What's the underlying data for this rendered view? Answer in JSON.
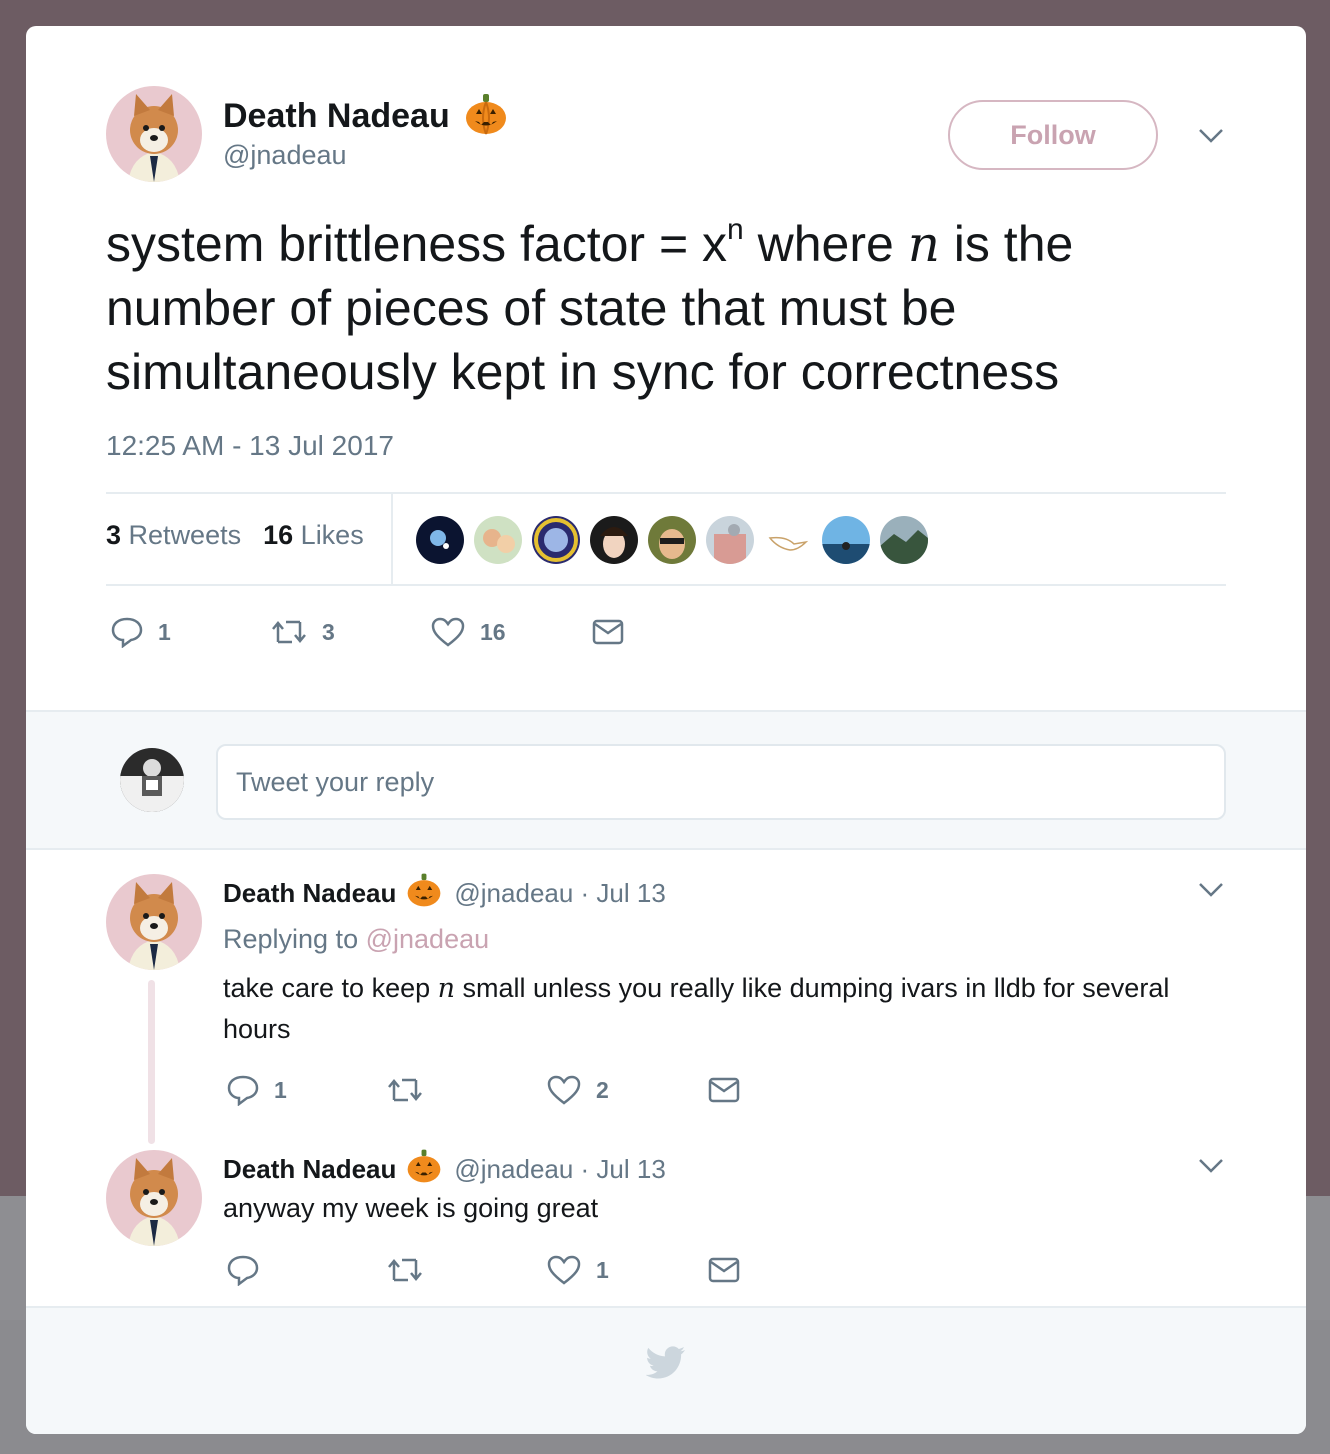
{
  "tweet": {
    "author_name": "Death Nadeau",
    "author_handle": "@jnadeau",
    "follow_label": "Follow",
    "text_part1": "system brittleness factor = x",
    "text_sup": "n",
    "text_part2": " where ",
    "text_var": "n",
    "text_part3": " is the number of pieces of state that must be simultaneously kept in sync for correctness",
    "timestamp": "12:25 AM - 13 Jul 2017",
    "retweets_count": "3",
    "retweets_label": "Retweets",
    "likes_count": "16",
    "likes_label": "Likes",
    "actions": {
      "replies": "1",
      "retweets": "3",
      "likes": "16"
    }
  },
  "reply_box": {
    "placeholder": "Tweet your reply"
  },
  "replies": [
    {
      "name": "Death Nadeau",
      "handle_date": "@jnadeau · Jul 13",
      "replying_prefix": "Replying to",
      "replying_to": "@jnadeau",
      "text_part1": "take care to keep ",
      "text_var": "n",
      "text_part2": " small unless you really like dumping ivars in lldb for several hours",
      "actions": {
        "replies": "1",
        "retweets": "",
        "likes": "2"
      }
    },
    {
      "name": "Death Nadeau",
      "handle_date": "@jnadeau · Jul 13",
      "text": "anyway my week is going great",
      "actions": {
        "replies": "",
        "retweets": "",
        "likes": "1"
      }
    }
  ],
  "colors": {
    "accent": "#c9a3b1",
    "text_primary": "#14171a",
    "text_secondary": "#657786",
    "background": "#6d5c63"
  }
}
